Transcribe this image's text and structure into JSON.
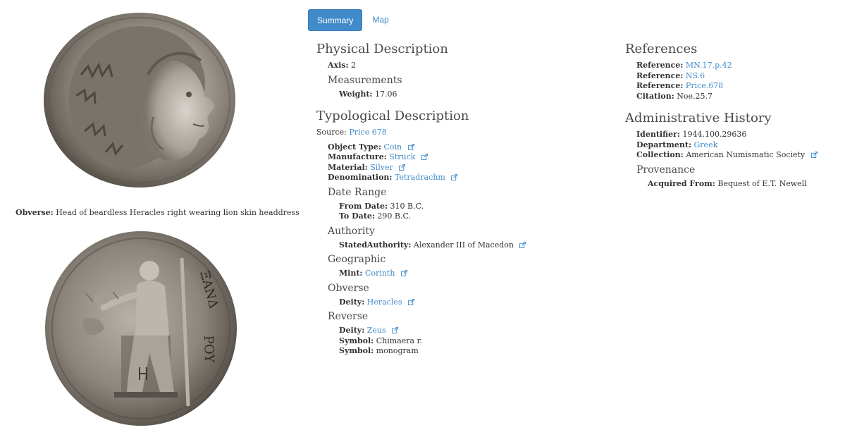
{
  "tabs": [
    {
      "label": "Summary",
      "active": true
    },
    {
      "label": "Map",
      "active": false
    }
  ],
  "images": {
    "obverse_caption_label": "Obverse:",
    "obverse_caption_text": "Head of beardless Heracles right wearing lion skin headdress"
  },
  "physical": {
    "title": "Physical Description",
    "axis_label": "Axis:",
    "axis_value": "2",
    "measurements_title": "Measurements",
    "weight_label": "Weight:",
    "weight_value": "17.06"
  },
  "typological": {
    "title": "Typological Description",
    "source_label": "Source:",
    "source_value": "Price 678",
    "object_type_label": "Object Type:",
    "object_type_value": "Coin",
    "manufacture_label": "Manufacture:",
    "manufacture_value": "Struck",
    "material_label": "Material:",
    "material_value": "Silver",
    "denomination_label": "Denomination:",
    "denomination_value": "Tetradrachm",
    "date_range_title": "Date Range",
    "from_date_label": "From Date:",
    "from_date_value": "310 B.C.",
    "to_date_label": "To Date:",
    "to_date_value": "290 B.C.",
    "authority_title": "Authority",
    "stated_authority_label": "StatedAuthority:",
    "stated_authority_value": "Alexander III of Macedon",
    "geographic_title": "Geographic",
    "mint_label": "Mint:",
    "mint_value": "Corinth",
    "obverse_title": "Obverse",
    "obverse_deity_label": "Deity:",
    "obverse_deity_value": "Heracles",
    "reverse_title": "Reverse",
    "reverse_deity_label": "Deity:",
    "reverse_deity_value": "Zeus",
    "symbol1_label": "Symbol:",
    "symbol1_value": "Chimaera r.",
    "symbol2_label": "Symbol:",
    "symbol2_value": "monogram"
  },
  "references": {
    "title": "References",
    "items": [
      {
        "label": "Reference:",
        "value": "MN.17.p.42",
        "link": true
      },
      {
        "label": "Reference:",
        "value": "NS.6",
        "link": true
      },
      {
        "label": "Reference:",
        "value": "Price.678",
        "link": true
      },
      {
        "label": "Citation:",
        "value": "Noe.25.7",
        "link": false
      }
    ]
  },
  "admin": {
    "title": "Administrative History",
    "identifier_label": "Identifier:",
    "identifier_value": "1944.100.29636",
    "department_label": "Department:",
    "department_value": "Greek",
    "collection_label": "Collection:",
    "collection_value": "American Numismatic Society",
    "provenance_title": "Provenance",
    "acquired_label": "Acquired From:",
    "acquired_value": "Bequest of E.T. Newell"
  },
  "colors": {
    "link": "#428bca",
    "tab_active_bg": "#428bca",
    "heading": "#4a4a4a"
  }
}
